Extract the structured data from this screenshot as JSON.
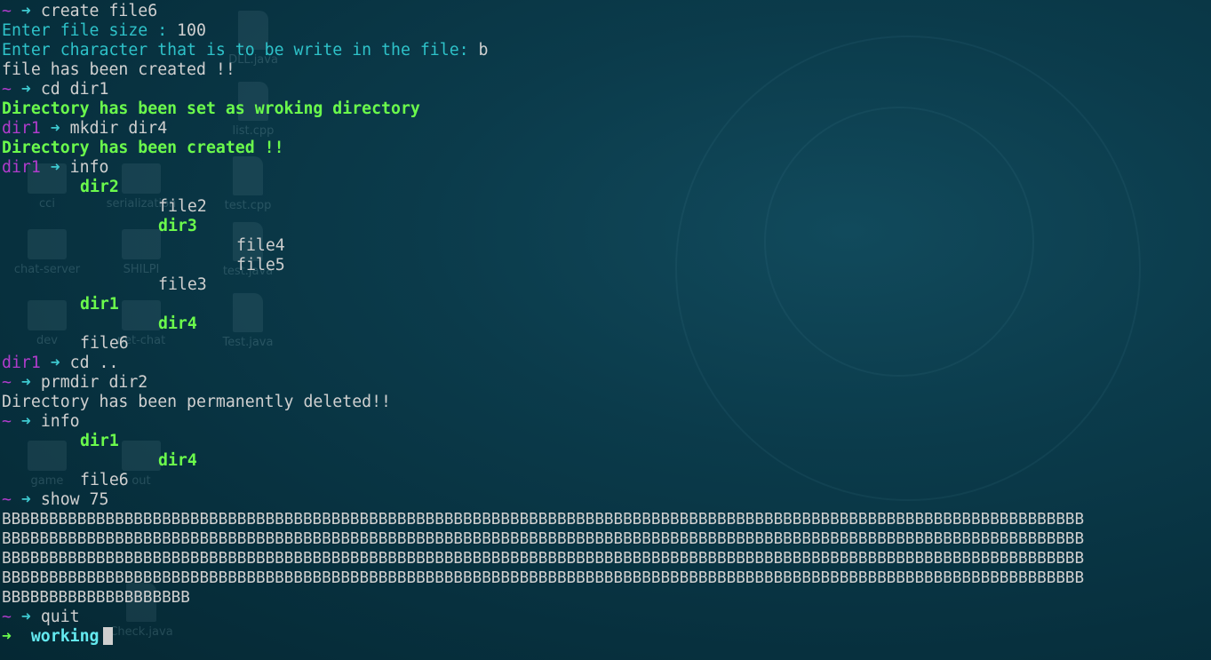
{
  "desktop": {
    "icons": [
      "DLL.java",
      "list.cpp",
      "cci",
      "serialization",
      "test.cpp",
      "chat-server",
      "SHILPI",
      "test.java",
      "dev",
      "net-chat",
      "Test.java",
      "game",
      "out",
      "Check.java"
    ]
  },
  "prompt": {
    "home": "~",
    "arrow": "➜",
    "dir1": "dir1"
  },
  "terminal": {
    "cmd_create": "create file6",
    "file_size_label": "Enter file size : ",
    "file_size_value": "100",
    "char_label": "Enter character that is to be write in the file: ",
    "char_value": "b",
    "created_msg": "file has been created !!",
    "cmd_cd_dir1": "cd dir1",
    "working_dir_msg": "Directory has been set as wroking directory",
    "cmd_mkdir": "mkdir dir4",
    "dir_created_msg": "Directory has been created !!",
    "cmd_info": "info",
    "tree1": {
      "dir2": "dir2",
      "file2": "file2",
      "dir3": "dir3",
      "file4": "file4",
      "file5": "file5",
      "file3": "file3",
      "dir1": "dir1",
      "dir4": "dir4",
      "file6": "file6"
    },
    "cmd_cd_up": "cd ..",
    "cmd_prmdir": "prmdir dir2",
    "deleted_msg": "Directory has been permanently deleted!!",
    "tree2": {
      "dir1": "dir1",
      "dir4": "dir4",
      "file6": "file6"
    },
    "cmd_show": "show 75",
    "b_lines": [
      "BBBBBBBBBBBBBBBBBBBBBBBBBBBBBBBBBBBBBBBBBBBBBBBBBBBBBBBBBBBBBBBBBBBBBBBBBBBBBBBBBBBBBBBBBBBBBBBBBBBBBBBBBBBBBBBBBBB",
      "BBBBBBBBBBBBBBBBBBBBBBBBBBBBBBBBBBBBBBBBBBBBBBBBBBBBBBBBBBBBBBBBBBBBBBBBBBBBBBBBBBBBBBBBBBBBBBBBBBBBBBBBBBBBBBBBBBB",
      "BBBBBBBBBBBBBBBBBBBBBBBBBBBBBBBBBBBBBBBBBBBBBBBBBBBBBBBBBBBBBBBBBBBBBBBBBBBBBBBBBBBBBBBBBBBBBBBBBBBBBBBBBBBBBBBBBBB",
      "BBBBBBBBBBBBBBBBBBBBBBBBBBBBBBBBBBBBBBBBBBBBBBBBBBBBBBBBBBBBBBBBBBBBBBBBBBBBBBBBBBBBBBBBBBBBBBBBBBBBBBBBBBBBBBBBBBB",
      "BBBBBBBBBBBBBBBBBBBB"
    ],
    "cmd_quit": "quit",
    "final_dir": "working"
  }
}
